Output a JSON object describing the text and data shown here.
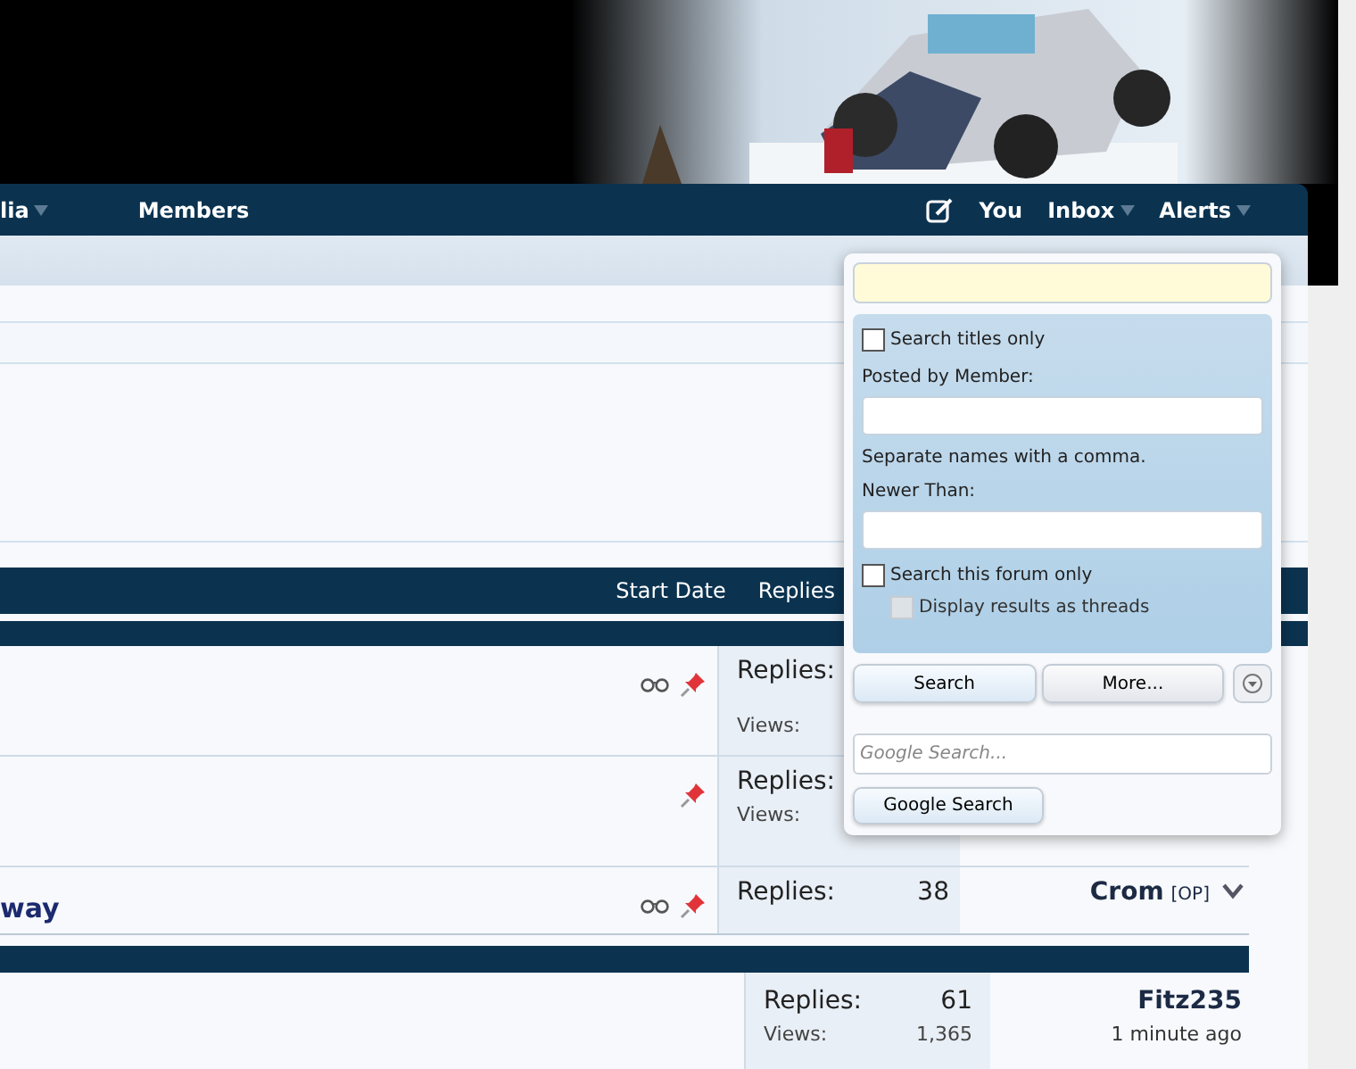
{
  "nav": {
    "items": [
      {
        "label": "lia",
        "caret": true
      },
      {
        "label": "Members",
        "caret": false
      }
    ],
    "user_items": [
      {
        "label": "You",
        "caret": false
      },
      {
        "label": "Inbox",
        "caret": true
      },
      {
        "label": "Alerts",
        "caret": true
      }
    ]
  },
  "thread_list": {
    "columns": [
      "Start Date",
      "Replies"
    ],
    "sticky_threads": [
      {
        "watched": true,
        "sticky": true,
        "replies_label": "Replies:",
        "views_label": "Views:"
      },
      {
        "watched": false,
        "sticky": true,
        "replies_label": "Replies:",
        "views_label": "Views:"
      },
      {
        "title": "way",
        "watched": true,
        "sticky": true,
        "replies_label": "Replies:",
        "replies": "38",
        "last_poster": "Crom",
        "op_tag": "[OP]"
      }
    ],
    "threads": [
      {
        "replies_label": "Replies:",
        "replies": "61",
        "views_label": "Views:",
        "views": "1,365",
        "last_poster": "Fitz235",
        "last_time": "1 minute ago"
      }
    ]
  },
  "search_popup": {
    "search_titles_only": {
      "label": "Search titles only",
      "checked": false
    },
    "posted_by_label": "Posted by Member:",
    "posted_by_hint": "Separate names with a comma.",
    "newer_than_label": "Newer Than:",
    "search_this_forum": {
      "label": "Search this forum only",
      "checked": false
    },
    "display_as_threads": {
      "label": "Display results as threads",
      "checked": false,
      "disabled": true
    },
    "buttons": [
      "Search",
      "More..."
    ],
    "google_search": {
      "placeholder": "Google Search...",
      "button": "Google Search"
    }
  }
}
